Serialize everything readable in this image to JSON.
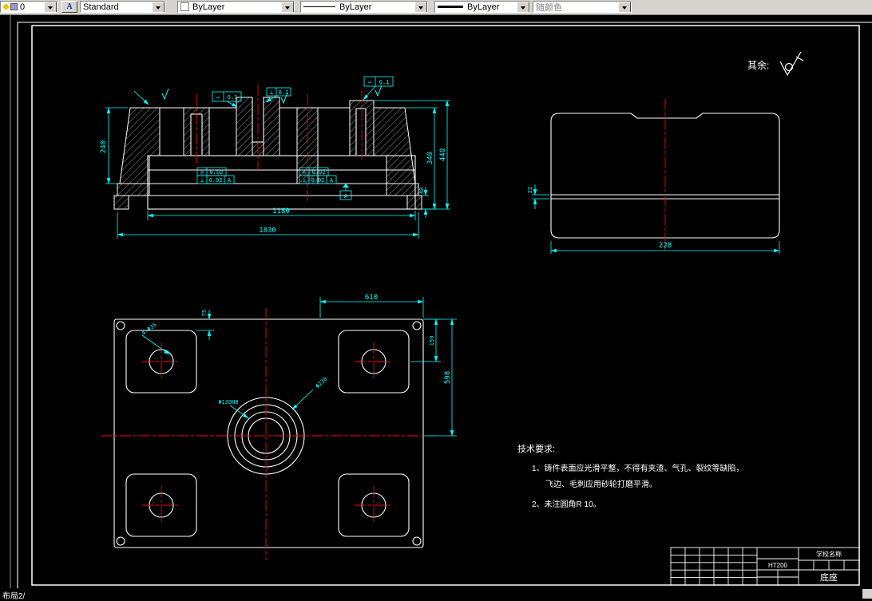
{
  "toolbar": {
    "layer_value": "0",
    "text_style_icon": "A",
    "style_value": "Standard",
    "color_value": "ByLayer",
    "linetype_value": "ByLayer",
    "lineweight_value": "ByLayer",
    "plotstyle_value": "随颜色"
  },
  "statusbar": {
    "layout_tabs": "布局2/"
  },
  "sheet": {
    "surface_note_label": "其余:",
    "tech_requirements": {
      "title": "技术要求:",
      "line1": "1、铸件表面应光滑平整，不得有夹渣、气孔、裂纹等缺陷，",
      "line2": "飞边、毛刺应用砂轮打磨平滑。",
      "line3": "2、未注圆角R 10。"
    },
    "title_block": {
      "school": "学校名称",
      "material": "HT200",
      "part_name": "底座"
    }
  },
  "dims": {
    "section": {
      "overall_width": "1830",
      "inner_width": "1180",
      "height_left": "240",
      "height_right_inner": "340",
      "height_right_outer": "440",
      "foot_height": "40",
      "flatness": "0.1",
      "perpendicularity": "0.1",
      "concentricity_tol": "0.02",
      "position_tol": "0.02",
      "datum": "A",
      "sym_flatness": "▱",
      "sym_perp": "⊥",
      "sym_conc": "◎"
    },
    "side": {
      "width": "228",
      "flange": "22"
    },
    "plan": {
      "top_width": "610",
      "pad_offset": "75",
      "right_short": "150",
      "right_long": "598",
      "corner_holes": "4-Φ35",
      "bore": "Φ130H8",
      "boss": "Φ230"
    }
  },
  "colors": {
    "geometry": "#ffffff",
    "dimension": "#00ffff",
    "centerline": "#ff0000",
    "background": "#000000",
    "toolbar": "#d6d3ce"
  }
}
